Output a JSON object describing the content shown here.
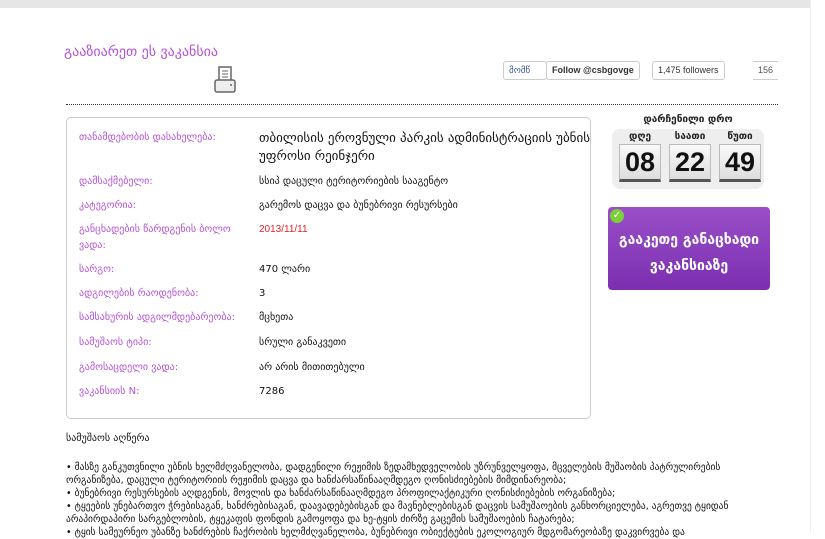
{
  "share": {
    "title": "გააზიარეთ ეს ვაკანსია",
    "like_label": "მომწ",
    "follow_label": "Follow @csbgovge",
    "followers": "1,475 followers",
    "count": "156"
  },
  "details": [
    {
      "label": "თანამდებობის დასახელება:",
      "value": "თბილისის ეროვნული პარკის ადმინისტრაციის უბნის უფროსი რეინჯერი"
    },
    {
      "label": "დამსაქმებელი:",
      "value": "სსიპ დაცული ტერიტორიების სააგენტო"
    },
    {
      "label": "კატეგორია:",
      "value": "გარემოს დაცვა და ბუნებრივი რესურსები"
    },
    {
      "label": "განცხადების წარდგენის ბოლო ვადა:",
      "value": "2013/11/11"
    },
    {
      "label": "სარგო:",
      "value": "470 ლარი"
    },
    {
      "label": "ადგილების რაოდენობა:",
      "value": "3"
    },
    {
      "label": "სამსახურის ადგილმდებარეობა:",
      "value": "მცხეთა"
    },
    {
      "label": "სამუშაოს ტიპი:",
      "value": "სრული განაკვეთი"
    },
    {
      "label": "გამოსაცდელი ვადა:",
      "value": "არ არის მითითებული"
    },
    {
      "label": "ვაკანსიის N:",
      "value": "7286"
    }
  ],
  "timer": {
    "title": "დარჩენილი დრო",
    "units": [
      {
        "label": "დღე",
        "value": "08"
      },
      {
        "label": "საათი",
        "value": "22"
      },
      {
        "label": "წუთი",
        "value": "49"
      }
    ]
  },
  "apply_label": "გააკეთე განაცხადი ვაკანსიაზე",
  "description": {
    "title": "სამუშაოს აღწერა",
    "items": [
      "• მასზე განკუთვნილი უბნის ხელმძღვანელობა, დადგენილი რეჟიმის ზედამხედველობის უზრუნველყოფა, მცველების მუშაობის პატრულირების ორგანიზება, დაცული ტერიტორიის რეჟიმის დაცვა და ხანძარსაწინააღმდეგო ღონისძიებების მიმდინარეობა;",
      "• ბუნებრივი რესურსების აღდგენის, მოვლის და ხანძარსაწინააღმდეგო პროფილაქტიკური ღონისძიებების ორგანიზება;",
      "• ტყეების უნებართვო ჭრებისაგან, ხანძრებისაგან, დაავადებებისგან და მავნებლებისგან დაცვის სამუშაოების განხორციელება, აგრეთვე ტყიდან არაპირდაპირი სარგებლობის, ტყეკაფის ფონდის გამოყოფა და ხე-ტყის ძირზე გაცემის სამუშაოების ჩატარება;",
      "• ტყის სამეურნეო უბანზე ხანძრების ჩაქრობის ხელმძღვანელობა, ბუნებრივი ობიექტების ეკოლოგიურ მდგომარეობაზე დაკვირვება და"
    ]
  }
}
